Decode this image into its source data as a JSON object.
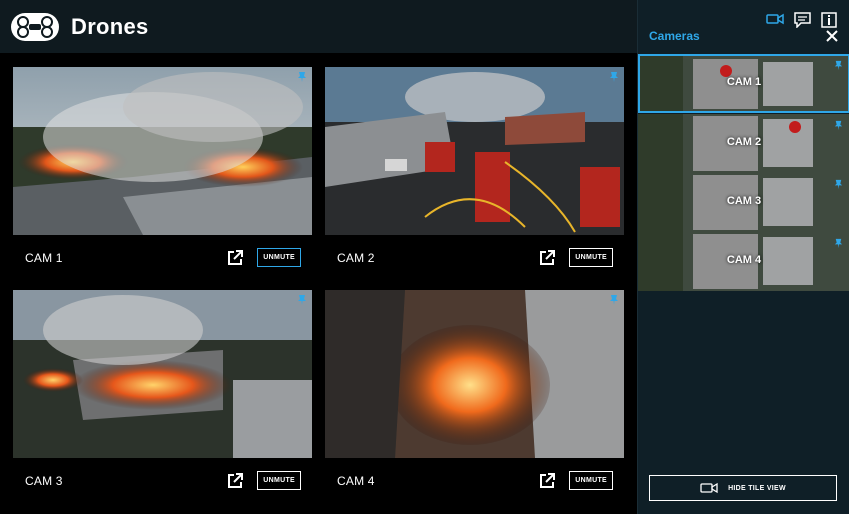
{
  "app": {
    "title": "Drones"
  },
  "tiles": [
    {
      "label": "CAM 1",
      "button": "UNMUTE"
    },
    {
      "label": "CAM 2",
      "button": "UNMUTE"
    },
    {
      "label": "CAM 3",
      "button": "UNMUTE"
    },
    {
      "label": "CAM 4",
      "button": "UNMUTE"
    }
  ],
  "panel": {
    "title": "Cameras",
    "thumbs": [
      {
        "label": "CAM 1"
      },
      {
        "label": "CAM 2"
      },
      {
        "label": "CAM 3"
      },
      {
        "label": "CAM 4"
      }
    ],
    "hide_button": "HIDE TILE VIEW"
  },
  "colors": {
    "accent": "#2fa7e8",
    "header_bg": "#0f1a1f",
    "panel_bg": "#0f1f27"
  }
}
